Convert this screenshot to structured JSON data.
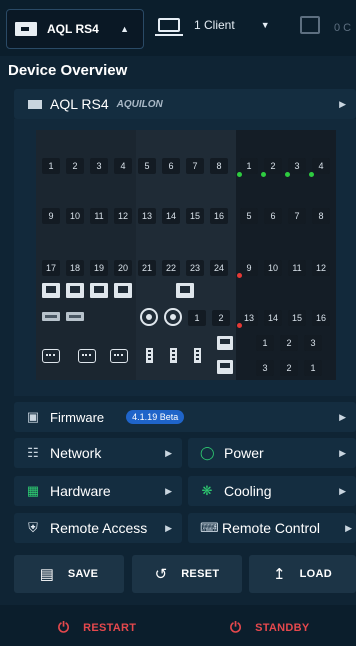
{
  "topbar": {
    "device_label": "AQL RS4",
    "client_label": "1 Client",
    "right_text": "0 C"
  },
  "overview_title": "Device Overview",
  "device": {
    "name": "AQL RS4",
    "model": "AQUILON"
  },
  "panel": {
    "ports_row1": [
      "1",
      "2",
      "3",
      "4",
      "5",
      "6",
      "7",
      "8"
    ],
    "ports_row2": [
      "9",
      "10",
      "11",
      "12",
      "13",
      "14",
      "15",
      "16"
    ],
    "ports_row3": [
      "17",
      "18",
      "19",
      "20",
      "21",
      "22",
      "23",
      "24"
    ],
    "out_row1": [
      "1",
      "2",
      "3",
      "4"
    ],
    "out_row2": [
      "5",
      "6",
      "7",
      "8"
    ],
    "out_row3": [
      "9",
      "10",
      "11",
      "12"
    ],
    "out_row4": [
      "13",
      "14",
      "15",
      "16"
    ],
    "mid_labels": [
      "1",
      "2"
    ],
    "aux_top": [
      "1",
      "2",
      "3"
    ],
    "aux_bottom": [
      "3",
      "2",
      "1"
    ]
  },
  "firmware": {
    "label": "Firmware",
    "version": "4.1.19 Beta"
  },
  "menu": {
    "network": "Network",
    "power": "Power",
    "hardware": "Hardware",
    "cooling": "Cooling",
    "remote_access": "Remote Access",
    "remote_control": "Remote Control"
  },
  "actions": {
    "save": "SAVE",
    "reset": "RESET",
    "load": "LOAD"
  },
  "power_actions": {
    "restart": "RESTART",
    "standby": "STANDBY"
  },
  "colors": {
    "accent": "#1f64c9",
    "led_green": "#2ecc40",
    "led_red": "#e53935",
    "danger": "#e5484d",
    "power_green": "#2ecc71",
    "hardware_green": "#2ecc71"
  },
  "icons": {
    "top_device": "device-icon",
    "client": "monitor-icon",
    "firmware": "chip-icon",
    "network": "network-icon",
    "power": "gauge-icon",
    "hardware": "hardware-icon",
    "cooling": "fan-icon",
    "remote_access": "shield-icon",
    "remote_control": "keyboard-icon",
    "save": "floppy-icon",
    "reset": "undo-icon",
    "load": "upload-icon",
    "restart": "power-icon",
    "standby": "power-icon"
  }
}
